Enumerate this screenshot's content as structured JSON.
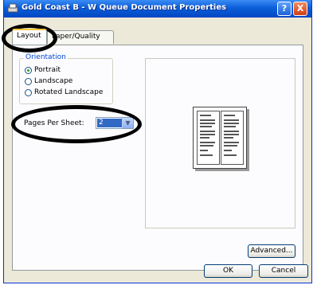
{
  "window": {
    "title": "Gold Coast B - W Queue Document Properties",
    "help_glyph": "?",
    "close_glyph": "X"
  },
  "tabs": [
    {
      "label": "Layout",
      "active": true
    },
    {
      "label": "Paper/Quality",
      "active": false
    }
  ],
  "orientation": {
    "title": "Orientation",
    "options": [
      {
        "label": "Portrait",
        "selected": true
      },
      {
        "label": "Landscape",
        "selected": false
      },
      {
        "label": "Rotated Landscape",
        "selected": false
      }
    ]
  },
  "pages_per_sheet": {
    "label": "Pages Per Sheet:",
    "value": "2"
  },
  "buttons": {
    "advanced": "Advanced...",
    "ok": "OK",
    "cancel": "Cancel"
  },
  "colors": {
    "titlebar": "#0b5ed8",
    "dialog_bg": "#ece9d8",
    "group_title": "#0046d5",
    "selection": "#316ac5"
  }
}
